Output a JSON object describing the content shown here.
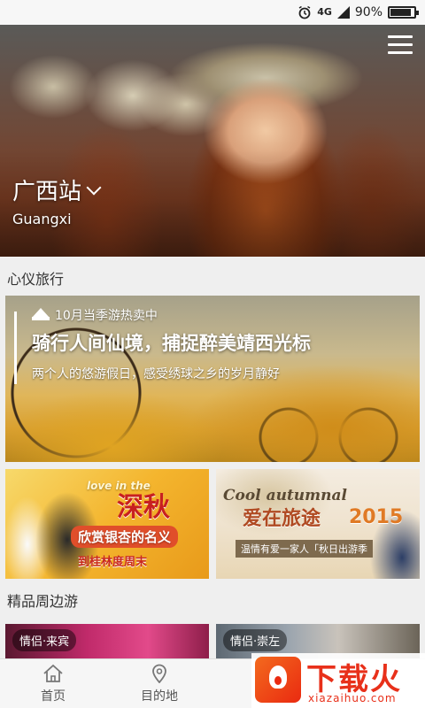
{
  "status_bar": {
    "network": "4G",
    "battery_text": "90%",
    "battery_level": 0.9
  },
  "hero": {
    "city": "广西站",
    "city_en": "Guangxi"
  },
  "sections": {
    "travel": "心仪旅行",
    "nearby": "精品周边游"
  },
  "feature": {
    "tag": "10月当季游热卖中",
    "headline": "骑行人间仙境，捕捉醉美靖西光标",
    "subtitle": "两个人的悠游假日，感受绣球之乡的岁月静好"
  },
  "promo_left": {
    "line1": "love in the",
    "line2": "深秋",
    "line3": "欣赏银杏的名义",
    "line4": "到桂林度周末"
  },
  "promo_right": {
    "line1": "Cool autumnal",
    "line2": "爱在旅途",
    "line3": "2015",
    "line4": "温情有爱一家人「秋日出游季"
  },
  "nearby_cards": [
    {
      "label": "情侣·来宾"
    },
    {
      "label": "情侣·崇左"
    }
  ],
  "tabs": [
    {
      "label": "首页",
      "icon": "home-icon"
    },
    {
      "label": "目的地",
      "icon": "location-pin-icon"
    }
  ],
  "watermark": {
    "brand": "下载火",
    "url": "xiazaihuo.com"
  }
}
